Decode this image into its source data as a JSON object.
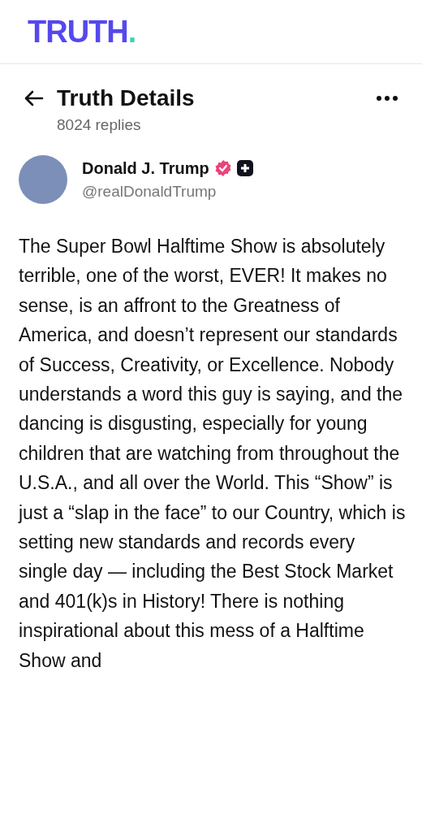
{
  "logo": {
    "word": "TRUTH",
    "dot": "."
  },
  "header": {
    "title": "Truth Details",
    "replies": "8024 replies"
  },
  "author": {
    "name": "Donald J. Trump",
    "handle": "@realDonaldTrump"
  },
  "post": {
    "text": "The Super Bowl Halftime Show is absolutely terrible, one of the worst, EVER! It makes no sense, is an affront to the Greatness of America, and doesn’t represent our standards of Success, Creativity, or Excellence. Nobody understands a word this guy is saying, and the dancing is disgusting, especially for young children that are watching from throughout the U.S.A., and all over the World. This “Show” is just a “slap in the face” to our Country, which is setting new standards and records every single day — including the Best Stock Market and 401(k)s in History! There is nothing inspirational about this mess of a Halftime Show and"
  }
}
